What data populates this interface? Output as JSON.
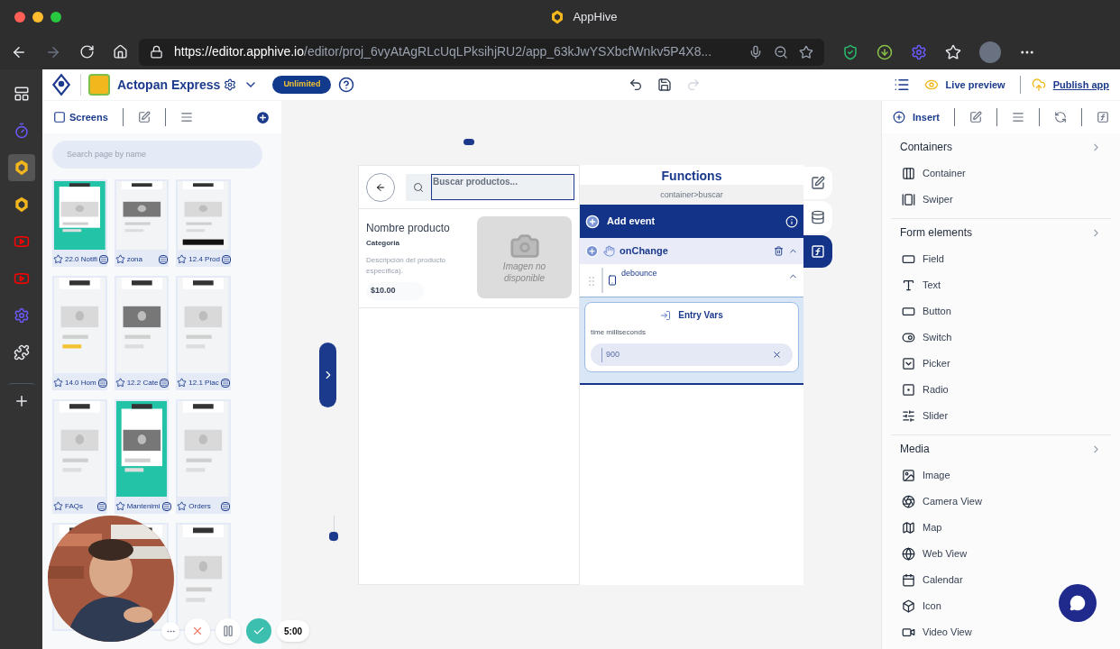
{
  "browser": {
    "title": "AppHive",
    "url_host": "https://editor.apphive.io",
    "url_path": "/editor/proj_6vyAtAgRLcUqLPksihjRU2/app_63kJwYSXbcfWnkv5P4X8..."
  },
  "app_sidebar": [
    {
      "selected": false
    },
    {
      "selected": false
    },
    {
      "selected": true
    },
    {
      "selected": false
    },
    {
      "selected": false
    },
    {
      "selected": false
    },
    {
      "selected": false
    },
    {
      "selected": false
    },
    {
      "selected": false
    }
  ],
  "header": {
    "project": "Actopan Express",
    "plan": "Unlimited",
    "live_preview": "Live preview",
    "publish": "Publish app"
  },
  "left_tabs": [
    {
      "label": "Screens",
      "selected": true
    },
    {
      "selected": false
    },
    {
      "selected": false
    }
  ],
  "search": {
    "placeholder": "Search page by name"
  },
  "screens": [
    {
      "label": "22.0 Notifi"
    },
    {
      "label": "zona"
    },
    {
      "label": "12.4 Prod"
    },
    {
      "label": "14.0 Hom"
    },
    {
      "label": "12.2 Cate"
    },
    {
      "label": "12.1 Plac"
    },
    {
      "label": "FAQs"
    },
    {
      "label": "Mantenimi"
    },
    {
      "label": "Orders"
    }
  ],
  "phone": {
    "search_placeholder": "Buscar productos...",
    "product_name": "Nombre producto",
    "category": "Categoria",
    "description": "Descripción del producto específica).",
    "price": "$10.00",
    "image_text": "Imagen no disponible"
  },
  "functions": {
    "title": "Functions",
    "path": "container>buscar",
    "add_event": "Add event",
    "event": "onChange",
    "action": "debounce",
    "entry_vars": "Entry Vars",
    "var_label": "time milliseconds",
    "var_value": "900"
  },
  "zoom_slider": {
    "level": 0.1
  },
  "side_tools": [
    {
      "selected": false
    },
    {
      "selected": false
    },
    {
      "selected": true
    }
  ],
  "right_tabs": [
    {
      "label": "Insert",
      "selected": true
    },
    {
      "selected": false
    },
    {
      "selected": false
    },
    {
      "selected": false
    },
    {
      "selected": false
    }
  ],
  "insert_sections": [
    {
      "title": "Containers",
      "items": [
        "Container",
        "Swiper"
      ]
    },
    {
      "title": "Form elements",
      "items": [
        "Field",
        "Text",
        "Button",
        "Switch",
        "Picker",
        "Radio",
        "Slider"
      ]
    },
    {
      "title": "Media",
      "items": [
        "Image",
        "Camera View",
        "Map",
        "Web View",
        "Calendar",
        "Icon",
        "Video View"
      ]
    }
  ],
  "recorder": {
    "time": "5:00"
  }
}
